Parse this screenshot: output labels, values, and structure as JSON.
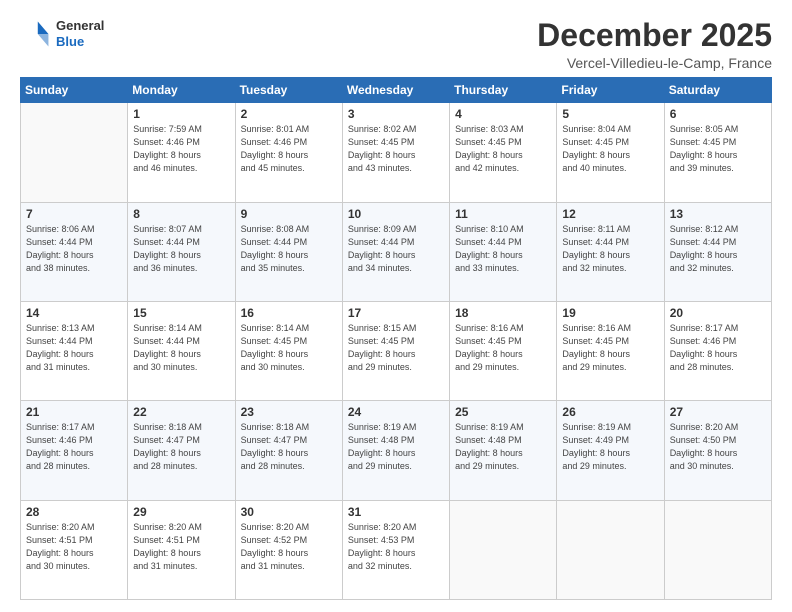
{
  "header": {
    "logo_general": "General",
    "logo_blue": "Blue",
    "month_title": "December 2025",
    "location": "Vercel-Villedieu-le-Camp, France"
  },
  "days_of_week": [
    "Sunday",
    "Monday",
    "Tuesday",
    "Wednesday",
    "Thursday",
    "Friday",
    "Saturday"
  ],
  "weeks": [
    [
      {
        "day": "",
        "detail": ""
      },
      {
        "day": "1",
        "detail": "Sunrise: 7:59 AM\nSunset: 4:46 PM\nDaylight: 8 hours\nand 46 minutes."
      },
      {
        "day": "2",
        "detail": "Sunrise: 8:01 AM\nSunset: 4:46 PM\nDaylight: 8 hours\nand 45 minutes."
      },
      {
        "day": "3",
        "detail": "Sunrise: 8:02 AM\nSunset: 4:45 PM\nDaylight: 8 hours\nand 43 minutes."
      },
      {
        "day": "4",
        "detail": "Sunrise: 8:03 AM\nSunset: 4:45 PM\nDaylight: 8 hours\nand 42 minutes."
      },
      {
        "day": "5",
        "detail": "Sunrise: 8:04 AM\nSunset: 4:45 PM\nDaylight: 8 hours\nand 40 minutes."
      },
      {
        "day": "6",
        "detail": "Sunrise: 8:05 AM\nSunset: 4:45 PM\nDaylight: 8 hours\nand 39 minutes."
      }
    ],
    [
      {
        "day": "7",
        "detail": "Sunrise: 8:06 AM\nSunset: 4:44 PM\nDaylight: 8 hours\nand 38 minutes."
      },
      {
        "day": "8",
        "detail": "Sunrise: 8:07 AM\nSunset: 4:44 PM\nDaylight: 8 hours\nand 36 minutes."
      },
      {
        "day": "9",
        "detail": "Sunrise: 8:08 AM\nSunset: 4:44 PM\nDaylight: 8 hours\nand 35 minutes."
      },
      {
        "day": "10",
        "detail": "Sunrise: 8:09 AM\nSunset: 4:44 PM\nDaylight: 8 hours\nand 34 minutes."
      },
      {
        "day": "11",
        "detail": "Sunrise: 8:10 AM\nSunset: 4:44 PM\nDaylight: 8 hours\nand 33 minutes."
      },
      {
        "day": "12",
        "detail": "Sunrise: 8:11 AM\nSunset: 4:44 PM\nDaylight: 8 hours\nand 32 minutes."
      },
      {
        "day": "13",
        "detail": "Sunrise: 8:12 AM\nSunset: 4:44 PM\nDaylight: 8 hours\nand 32 minutes."
      }
    ],
    [
      {
        "day": "14",
        "detail": "Sunrise: 8:13 AM\nSunset: 4:44 PM\nDaylight: 8 hours\nand 31 minutes."
      },
      {
        "day": "15",
        "detail": "Sunrise: 8:14 AM\nSunset: 4:44 PM\nDaylight: 8 hours\nand 30 minutes."
      },
      {
        "day": "16",
        "detail": "Sunrise: 8:14 AM\nSunset: 4:45 PM\nDaylight: 8 hours\nand 30 minutes."
      },
      {
        "day": "17",
        "detail": "Sunrise: 8:15 AM\nSunset: 4:45 PM\nDaylight: 8 hours\nand 29 minutes."
      },
      {
        "day": "18",
        "detail": "Sunrise: 8:16 AM\nSunset: 4:45 PM\nDaylight: 8 hours\nand 29 minutes."
      },
      {
        "day": "19",
        "detail": "Sunrise: 8:16 AM\nSunset: 4:45 PM\nDaylight: 8 hours\nand 29 minutes."
      },
      {
        "day": "20",
        "detail": "Sunrise: 8:17 AM\nSunset: 4:46 PM\nDaylight: 8 hours\nand 28 minutes."
      }
    ],
    [
      {
        "day": "21",
        "detail": "Sunrise: 8:17 AM\nSunset: 4:46 PM\nDaylight: 8 hours\nand 28 minutes."
      },
      {
        "day": "22",
        "detail": "Sunrise: 8:18 AM\nSunset: 4:47 PM\nDaylight: 8 hours\nand 28 minutes."
      },
      {
        "day": "23",
        "detail": "Sunrise: 8:18 AM\nSunset: 4:47 PM\nDaylight: 8 hours\nand 28 minutes."
      },
      {
        "day": "24",
        "detail": "Sunrise: 8:19 AM\nSunset: 4:48 PM\nDaylight: 8 hours\nand 29 minutes."
      },
      {
        "day": "25",
        "detail": "Sunrise: 8:19 AM\nSunset: 4:48 PM\nDaylight: 8 hours\nand 29 minutes."
      },
      {
        "day": "26",
        "detail": "Sunrise: 8:19 AM\nSunset: 4:49 PM\nDaylight: 8 hours\nand 29 minutes."
      },
      {
        "day": "27",
        "detail": "Sunrise: 8:20 AM\nSunset: 4:50 PM\nDaylight: 8 hours\nand 30 minutes."
      }
    ],
    [
      {
        "day": "28",
        "detail": "Sunrise: 8:20 AM\nSunset: 4:51 PM\nDaylight: 8 hours\nand 30 minutes."
      },
      {
        "day": "29",
        "detail": "Sunrise: 8:20 AM\nSunset: 4:51 PM\nDaylight: 8 hours\nand 31 minutes."
      },
      {
        "day": "30",
        "detail": "Sunrise: 8:20 AM\nSunset: 4:52 PM\nDaylight: 8 hours\nand 31 minutes."
      },
      {
        "day": "31",
        "detail": "Sunrise: 8:20 AM\nSunset: 4:53 PM\nDaylight: 8 hours\nand 32 minutes."
      },
      {
        "day": "",
        "detail": ""
      },
      {
        "day": "",
        "detail": ""
      },
      {
        "day": "",
        "detail": ""
      }
    ]
  ]
}
